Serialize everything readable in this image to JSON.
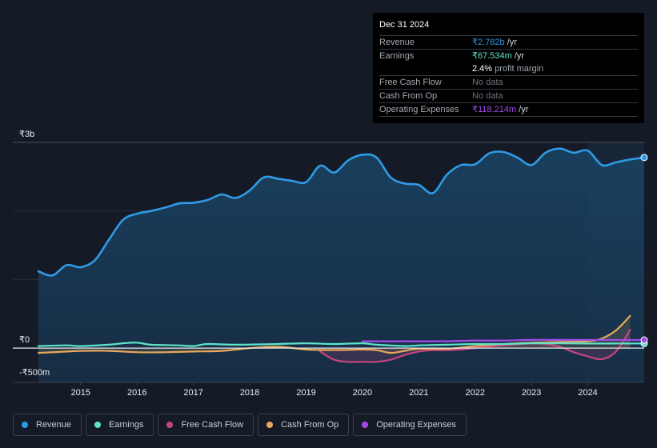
{
  "tooltip": {
    "date": "Dec 31 2024",
    "rows": [
      {
        "label": "Revenue",
        "value": "₹2.782b",
        "unit": " /yr",
        "color": "#2f9be6"
      },
      {
        "label": "Earnings",
        "value": "₹67.534m",
        "unit": " /yr",
        "color": "#5ee3c9"
      },
      {
        "label": "",
        "value": "2.4%",
        "unit": " profit margin",
        "color": "#ffffff"
      },
      {
        "label": "Free Cash Flow",
        "value": "No data",
        "unit": "",
        "color": "#6d737c"
      },
      {
        "label": "Cash From Op",
        "value": "No data",
        "unit": "",
        "color": "#6d737c"
      },
      {
        "label": "Operating Expenses",
        "value": "₹118.214m",
        "unit": " /yr",
        "color": "#a24ce8"
      }
    ]
  },
  "legend": [
    {
      "label": "Revenue",
      "color": "#2f9be6"
    },
    {
      "label": "Earnings",
      "color": "#5ee3c9"
    },
    {
      "label": "Free Cash Flow",
      "color": "#c5457f"
    },
    {
      "label": "Cash From Op",
      "color": "#e6a85a"
    },
    {
      "label": "Operating Expenses",
      "color": "#a24ce8"
    }
  ],
  "chart_data": {
    "type": "area",
    "title": "",
    "xlabel": "",
    "ylabel": "",
    "unit": "₹ billions",
    "ylim": [
      -0.5,
      3.0
    ],
    "xlim": [
      2014.25,
      2025.0
    ],
    "y_tick_labels": [
      {
        "value": 3.0,
        "label": "₹3b"
      },
      {
        "value": 0.0,
        "label": "₹0"
      },
      {
        "value": -0.5,
        "label": "-₹500m"
      }
    ],
    "x_tick_labels": [
      "2015",
      "2016",
      "2017",
      "2018",
      "2019",
      "2020",
      "2021",
      "2022",
      "2023",
      "2024"
    ],
    "x_ticks": [
      2015,
      2016,
      2017,
      2018,
      2019,
      2020,
      2021,
      2022,
      2023,
      2024
    ],
    "gridlines": [
      3.0,
      2.0,
      1.0,
      0.0
    ],
    "highlight_from": 2024.0,
    "series": [
      {
        "name": "Revenue",
        "color": "#2f9be6",
        "fill": true,
        "x": [
          2014.25,
          2014.5,
          2014.75,
          2015.0,
          2015.25,
          2015.5,
          2015.75,
          2016.0,
          2016.25,
          2016.5,
          2016.75,
          2017.0,
          2017.25,
          2017.5,
          2017.75,
          2018.0,
          2018.25,
          2018.5,
          2018.75,
          2019.0,
          2019.25,
          2019.5,
          2019.75,
          2020.0,
          2020.25,
          2020.5,
          2020.75,
          2021.0,
          2021.25,
          2021.5,
          2021.75,
          2022.0,
          2022.25,
          2022.5,
          2022.75,
          2023.0,
          2023.25,
          2023.5,
          2023.75,
          2024.0,
          2024.25,
          2024.5,
          2024.75,
          2025.0
        ],
        "values": [
          1.12,
          1.06,
          1.21,
          1.18,
          1.28,
          1.58,
          1.87,
          1.96,
          2.0,
          2.05,
          2.11,
          2.12,
          2.16,
          2.24,
          2.19,
          2.3,
          2.49,
          2.47,
          2.44,
          2.42,
          2.66,
          2.56,
          2.74,
          2.82,
          2.78,
          2.49,
          2.4,
          2.38,
          2.26,
          2.53,
          2.67,
          2.68,
          2.84,
          2.86,
          2.78,
          2.67,
          2.85,
          2.91,
          2.85,
          2.88,
          2.67,
          2.71,
          2.75,
          2.78
        ]
      },
      {
        "name": "Earnings",
        "color": "#5ee3c9",
        "fill": false,
        "x": [
          2014.25,
          2014.75,
          2015.0,
          2015.5,
          2015.75,
          2016.0,
          2016.25,
          2016.75,
          2017.0,
          2017.25,
          2017.75,
          2018.5,
          2019.0,
          2019.5,
          2020.0,
          2020.25,
          2020.75,
          2021.0,
          2021.5,
          2022.0,
          2022.5,
          2023.0,
          2023.5,
          2024.0,
          2024.5,
          2025.0
        ],
        "values": [
          0.03,
          0.04,
          0.03,
          0.05,
          0.07,
          0.08,
          0.05,
          0.04,
          0.03,
          0.06,
          0.05,
          0.06,
          0.07,
          0.06,
          0.07,
          0.05,
          0.03,
          0.04,
          0.05,
          0.06,
          0.06,
          0.07,
          0.07,
          0.067,
          0.067,
          0.068
        ]
      },
      {
        "name": "Free Cash Flow",
        "color": "#c5457f",
        "fill": true,
        "x": [
          2019.25,
          2019.5,
          2019.75,
          2020.0,
          2020.25,
          2020.5,
          2020.75,
          2021.0,
          2021.25,
          2021.5,
          2021.75,
          2022.0,
          2022.5,
          2023.0,
          2023.25,
          2023.5,
          2023.75,
          2024.0,
          2024.25,
          2024.5,
          2024.75
        ],
        "values": [
          -0.05,
          -0.17,
          -0.2,
          -0.2,
          -0.2,
          -0.17,
          -0.1,
          -0.05,
          -0.03,
          -0.03,
          -0.02,
          0.0,
          0.04,
          0.07,
          0.06,
          0.02,
          -0.06,
          -0.12,
          -0.16,
          -0.05,
          0.27
        ]
      },
      {
        "name": "Cash From Op",
        "color": "#e6a85a",
        "fill": true,
        "x": [
          2014.25,
          2014.75,
          2015.0,
          2015.5,
          2016.0,
          2016.5,
          2017.0,
          2017.5,
          2018.0,
          2018.5,
          2019.0,
          2019.5,
          2020.0,
          2020.25,
          2020.5,
          2020.75,
          2021.0,
          2021.5,
          2022.0,
          2022.5,
          2023.0,
          2023.5,
          2024.0,
          2024.25,
          2024.5,
          2024.75
        ],
        "values": [
          -0.07,
          -0.05,
          -0.04,
          -0.04,
          -0.06,
          -0.06,
          -0.05,
          -0.04,
          0.0,
          0.02,
          -0.02,
          -0.03,
          -0.02,
          -0.03,
          -0.07,
          -0.04,
          -0.01,
          -0.01,
          0.03,
          0.06,
          0.08,
          0.09,
          0.1,
          0.14,
          0.26,
          0.47
        ]
      },
      {
        "name": "Operating Expenses",
        "color": "#a24ce8",
        "fill": false,
        "x": [
          2020.0,
          2020.5,
          2021.0,
          2021.5,
          2022.0,
          2022.5,
          2023.0,
          2023.5,
          2024.0,
          2024.5,
          2025.0
        ],
        "values": [
          0.1,
          0.1,
          0.1,
          0.1,
          0.11,
          0.11,
          0.12,
          0.12,
          0.12,
          0.118,
          0.118
        ]
      }
    ]
  }
}
